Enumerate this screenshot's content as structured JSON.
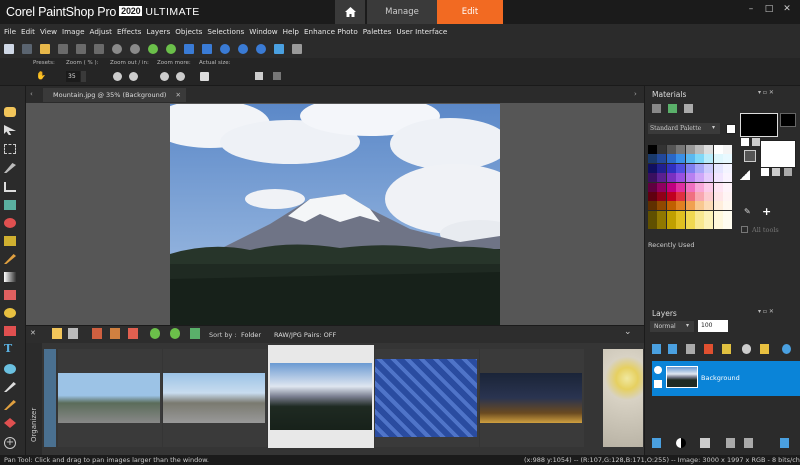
{
  "app": {
    "name": "Corel PaintShop Pro",
    "year": "2020",
    "edition": "ULTIMATE"
  },
  "workspace_tabs": [
    "Manage",
    "Edit"
  ],
  "window_controls": [
    "–",
    "□",
    "✕"
  ],
  "menu": [
    "File",
    "Edit",
    "View",
    "Image",
    "Adjust",
    "Effects",
    "Layers",
    "Objects",
    "Selections",
    "Window",
    "Help",
    "Enhance Photo",
    "Palettes",
    "User Interface"
  ],
  "options": {
    "presets_label": "Presets:",
    "zoom_label": "Zoom ( % ):",
    "zoom_value": "35",
    "zoom_out_in_label": "Zoom out / in:",
    "zoom_more_label": "Zoom more:",
    "actual_size_label": "Actual size:"
  },
  "document_tab": "Mountain.jpg @  35% (Background)",
  "organizer": {
    "label": "Organizer",
    "sort_label": "Sort by :",
    "sort_value": "Folder",
    "raw_label": "RAW/JPG Pairs: OFF"
  },
  "materials": {
    "title": "Materials",
    "palette": "Standard Palette",
    "all_tools": "All tools",
    "recently_used": "Recently Used"
  },
  "layers": {
    "title": "Layers",
    "blend_mode": "Normal",
    "opacity": "100",
    "layer_name": "Background"
  },
  "status": {
    "left": "Pan Tool: Click and drag to pan images larger than the window.",
    "right": "(x:988 y:1054) -- (R:107,G:128,B:171,O:255) -- Image:  3000 x 1997 x RGB - 8 bits/channel"
  },
  "colors": {
    "accent": "#f26a22",
    "layer_selected": "#0a84d8"
  }
}
